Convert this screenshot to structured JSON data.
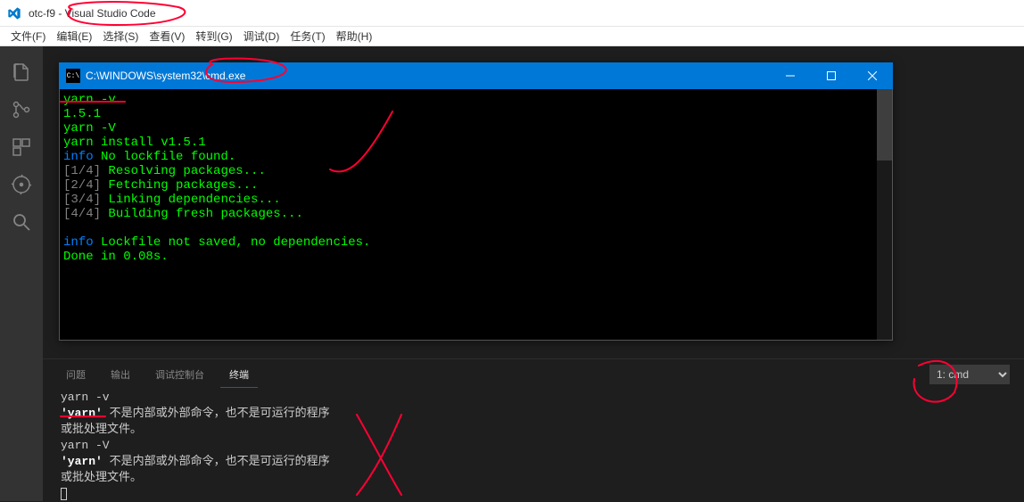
{
  "window": {
    "title": "otc-f9 - Visual Studio Code"
  },
  "menu": {
    "file": "文件(F)",
    "edit": "编辑(E)",
    "select": "选择(S)",
    "view": "查看(V)",
    "goto": "转到(G)",
    "debug": "调试(D)",
    "tasks": "任务(T)",
    "help": "帮助(H)"
  },
  "cmd": {
    "title": "C:\\WINDOWS\\system32\\cmd.exe",
    "lines": {
      "l1": {
        "text": "yarn -v",
        "cls": "green"
      },
      "l2": {
        "text": "1.5.1",
        "cls": "green"
      },
      "l3": {
        "text": "yarn -V",
        "cls": "green"
      },
      "l4": {
        "text": "yarn install v1.5.1",
        "cls": "green"
      },
      "l5a": {
        "text": "info",
        "cls": "blue"
      },
      "l5b": {
        "text": " No lockfile found.",
        "cls": "green"
      },
      "l6a": {
        "text": "[1/4]",
        "cls": "grey"
      },
      "l6b": {
        "text": " Resolving packages...",
        "cls": "green"
      },
      "l7a": {
        "text": "[2/4]",
        "cls": "grey"
      },
      "l7b": {
        "text": " Fetching packages...",
        "cls": "green"
      },
      "l8a": {
        "text": "[3/4]",
        "cls": "grey"
      },
      "l8b": {
        "text": " Linking dependencies...",
        "cls": "green"
      },
      "l9a": {
        "text": "[4/4]",
        "cls": "grey"
      },
      "l9b": {
        "text": " Building fresh packages...",
        "cls": "green"
      },
      "l10": {
        "text": "",
        "cls": ""
      },
      "l11a": {
        "text": "info",
        "cls": "blue"
      },
      "l11b": {
        "text": " Lockfile not saved, no dependencies.",
        "cls": "green"
      },
      "l12": {
        "text": "Done in 0.08s.",
        "cls": "green"
      }
    }
  },
  "panel": {
    "tabs": {
      "problems": "问题",
      "output": "输出",
      "debug_console": "调试控制台",
      "terminal": "终端"
    },
    "terminal_select": "1: cmd",
    "lines": {
      "t1": "yarn -v",
      "t2a": "'yarn'",
      "t2b": " 不是内部或外部命令，也不是可运行的程序",
      "t3": "或批处理文件。",
      "t4": "yarn -V",
      "t5a": "'yarn'",
      "t5b": " 不是内部或外部命令，也不是可运行的程序",
      "t6": "或批处理文件。"
    }
  }
}
